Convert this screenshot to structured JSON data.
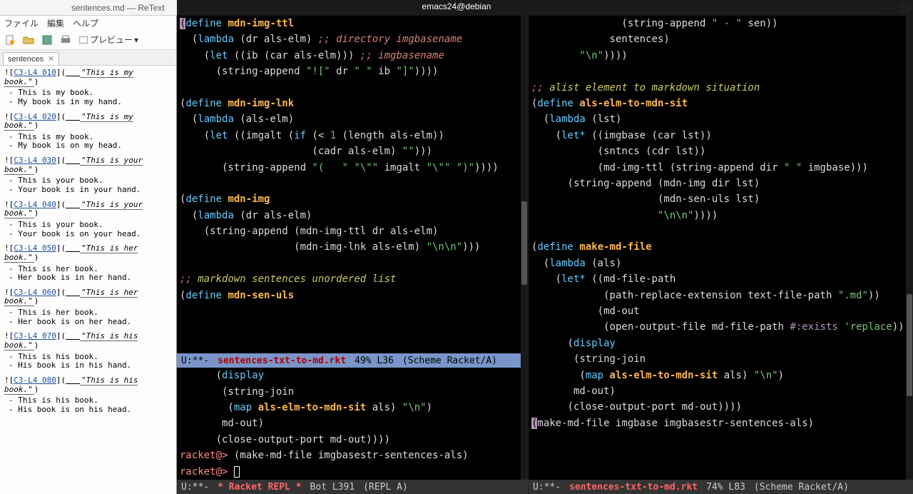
{
  "titlebar": {
    "retext_title": "sentences.md — ReText",
    "emacs_title": "emacs24@debian",
    "min": "—",
    "max": "▢",
    "close": "✕"
  },
  "retext": {
    "menu": {
      "file": "ファイル",
      "edit": "編集",
      "help": "ヘルプ"
    },
    "tools": {
      "preview": "プレビュー"
    },
    "tab": "sentences",
    "entries": [
      {
        "tag": "C3-L4 010",
        "alt": "\"This is my book.\"",
        "bullets": [
          "This is my book.",
          "My book is in my hand."
        ]
      },
      {
        "tag": "C3-L4 020",
        "alt": "\"This is my book.\"",
        "bullets": [
          "This is my book.",
          "My book is on my head."
        ]
      },
      {
        "tag": "C3-L4 030",
        "alt": "\"This is your book.\"",
        "bullets": [
          "This is your book.",
          "Your book is in your hand."
        ]
      },
      {
        "tag": "C3-L4 040",
        "alt": "\"This is your book.\"",
        "bullets": [
          "This is your book.",
          "Your book is on your head."
        ]
      },
      {
        "tag": "C3-L4 050",
        "alt": "\"This is her book.\"",
        "bullets": [
          "This is her book.",
          "Her book is in her hand."
        ]
      },
      {
        "tag": "C3-L4 060",
        "alt": "\"This is her book.\"",
        "bullets": [
          "This is her book.",
          "Her book is on her head."
        ]
      },
      {
        "tag": "C3-L4 070",
        "alt": "\"This is his book.\"",
        "bullets": [
          "This is his book.",
          "His book is in his hand."
        ]
      },
      {
        "tag": "C3-L4 080",
        "alt": "\"This is his book.\"",
        "bullets": [
          "This is his book.",
          "His book is on his head."
        ]
      }
    ]
  },
  "left_pane": {
    "code_lines": [
      "<span class='paren-hl'>(</span><span class='kw'>define</span> <span class='fn'>mdn-img-ttl</span>",
      "  (<span class='kw'>lambda</span> (dr als-elm) <span class='cm'>;; directory imgbasename</span>",
      "    (<span class='kw'>let</span> ((ib (car als-elm))) <span class='cm'>;; imgbasename</span>",
      "      (string-append <span class='str'>\"![\"</span> dr <span class='str'>\" \"</span> ib <span class='str'>\"]\"</span>))))",
      "",
      "(<span class='kw'>define</span> <span class='fn'>mdn-img-lnk</span>",
      "  (<span class='kw'>lambda</span> (als-elm)",
      "    (<span class='kw'>let</span> ((imgalt (<span class='kw'>if</span> (&lt; <span class='num'>1</span> (length als-elm))",
      "                      (cadr als-elm) <span class='str'>\"\"</span>)))",
      "       (string-append <span class='str'>\"(   \"</span> <span class='str'>\"\\\"\"</span> imgalt <span class='str'>\"\\\"\"</span> <span class='str'>\")\"</span>))))",
      "",
      "(<span class='kw'>define</span> <span class='fn'>mdn-img</span>",
      "  (<span class='kw'>lambda</span> (dr als-elm)",
      "    (string-append (mdn-img-ttl dr als-elm)",
      "                   (mdn-img-lnk als-elm) <span class='str'>\"\\n\\n\"</span>)))",
      "",
      "<span class='cm'>;;</span> <span class='cm2'>markdown sentences unordered list</span>",
      "(<span class='kw'>define</span> <span class='fn'>mdn-sen-uls</span>"
    ],
    "below_modeline": [
      "      (<span class='kw'>display</span>",
      "       (string-join",
      "        (<span class='kw'>map</span> <span class='fn'>als-elm-to-mdn-sit</span> als) <span class='str'>\"\\n\"</span>)",
      "       md-out)",
      "      (close-output-port md-out))))",
      "<span class='prompt'>racket@&gt;</span> (make-md-file imgbasestr-sentences-als)",
      "<span class='prompt'>racket@&gt;</span> <span class='cursor'></span>"
    ],
    "modeline_top": {
      "left": "U:**-",
      "file": "sentences-txt-to-md.rkt",
      "pct": "49% L36",
      "mode": "(Scheme Racket/A)"
    },
    "modeline_bot": {
      "left": "U:**-",
      "file": "* Racket REPL *",
      "pct": "Bot L391",
      "mode": "(REPL A)"
    }
  },
  "right_pane": {
    "code_lines": [
      "               (string-append <span class='str'>\" - \"</span> sen))",
      "             sentences)",
      "        <span class='str'>\"\\n\"</span>))))",
      "",
      "<span class='cm'>;;</span> <span class='cm2'>alist element to markdown situation</span>",
      "(<span class='kw'>define</span> <span class='fn'>als-elm-to-mdn-sit</span>",
      "  (<span class='kw'>lambda</span> (lst)",
      "    (<span class='kw'>let*</span> ((imgbase (car lst))",
      "           (sntncs (cdr lst))",
      "           (md-img-ttl (string-append dir <span class='str'>\" \"</span> imgbase)))",
      "      (string-append (mdn-img dir lst)",
      "                     (mdn-sen-uls lst)",
      "                     <span class='str'>\"\\n\\n\"</span>))))",
      "",
      "(<span class='kw'>define</span> <span class='fn'>make-md-file</span>",
      "  (<span class='kw'>lambda</span> (als)",
      "    (<span class='kw'>let*</span> ((md-file-path",
      "            (path-replace-extension text-file-path <span class='str'>\".md\"</span>))",
      "           (md-out",
      "            (open-output-file md-file-path <span class='num'>#:exists</span> <span class='str'>'replace</span>)))",
      "      (<span class='kw'>display</span>",
      "       (string-join",
      "        (<span class='kw'>map</span> <span class='fn'>als-elm-to-mdn-sit</span> als) <span class='str'>\"\\n\"</span>)",
      "       md-out)",
      "      (close-output-port md-out))))",
      "<span class='paren-hl'>(</span>make-md-file imgbase imgbasestr-sentences-als)"
    ],
    "modeline": {
      "left": "U:**-",
      "file": "sentences-txt-to-md.rkt",
      "pct": "74% L83",
      "mode": "(Scheme Racket/A)"
    }
  }
}
